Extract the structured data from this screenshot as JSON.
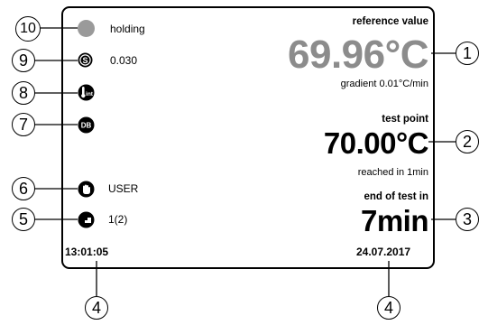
{
  "status": {
    "holding_label": "holding",
    "stability_value": "0.030",
    "mode_label": "USER",
    "program_step": "1(2)"
  },
  "reference": {
    "header": "reference value",
    "value": "69.96°C",
    "gradient": "gradient 0.01°C/min"
  },
  "test_point": {
    "header": "test point",
    "value": "70.00°C",
    "reached": "reached in  1min"
  },
  "end_of_test": {
    "header": "end of test in",
    "value": "7min"
  },
  "footer": {
    "time": "13:01:05",
    "date": "24.07.2017"
  },
  "callouts": {
    "c1": "1",
    "c2": "2",
    "c3": "3",
    "c4a": "4",
    "c4b": "4",
    "c5": "5",
    "c6": "6",
    "c7": "7",
    "c8": "8",
    "c9": "9",
    "c10": "10"
  },
  "icons": {
    "holding": "gray-dot-icon",
    "stability": "stability-s-icon",
    "internal_sensor": "thermometer-int-icon",
    "database": "db-icon",
    "user": "hand-icon",
    "program": "step-icon"
  },
  "colors": {
    "reference_value": "#8c8c8c",
    "holding_dot": "#9a9a9a"
  }
}
